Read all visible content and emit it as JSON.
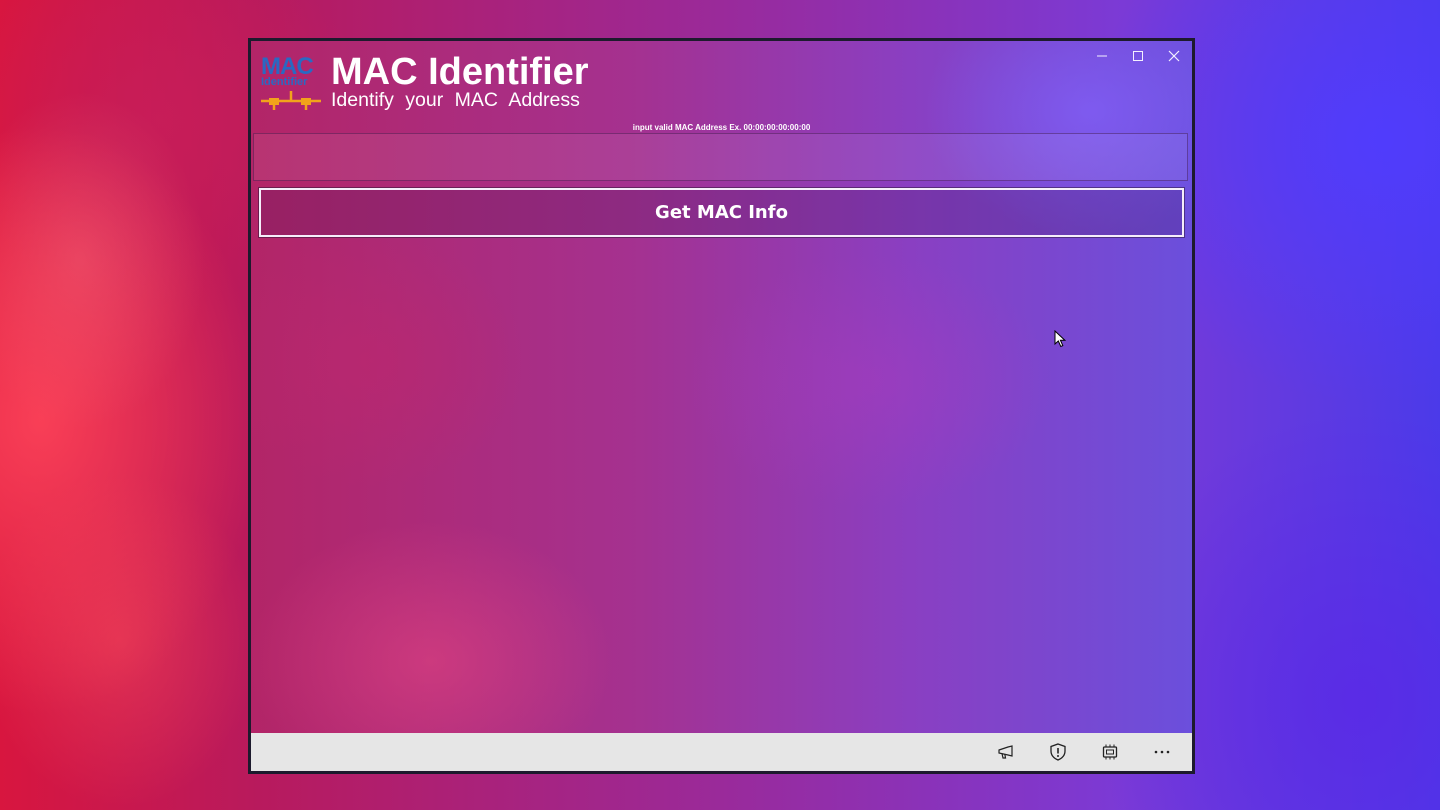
{
  "app": {
    "title": "MAC Identifier",
    "subtitle": "Identify your MAC Address",
    "logo_text": "MAC",
    "logo_subtext": "Identifier"
  },
  "input": {
    "hint": "input valid MAC Address Ex. 00:00:00:00:00:00",
    "value": "",
    "placeholder": ""
  },
  "actions": {
    "get_info_label": "Get MAC Info"
  },
  "window_controls": [
    "minimize-icon",
    "maximize-icon",
    "close-icon"
  ],
  "bottom_bar": {
    "icons": [
      "megaphone-icon",
      "shield-icon",
      "chip-icon",
      "more-icon"
    ]
  },
  "colors": {
    "accent_blue": "#2a69c2",
    "logo_orange": "#f2a31b",
    "bar_bg": "#e6e6e6"
  }
}
